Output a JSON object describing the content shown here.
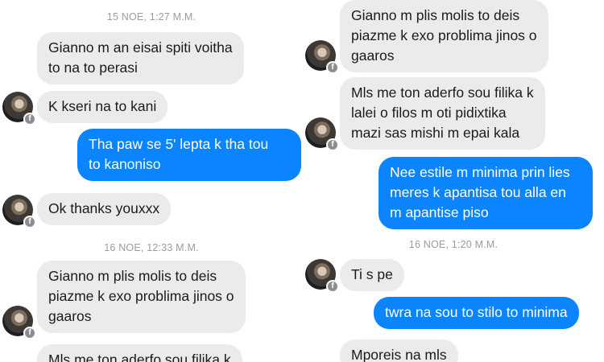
{
  "left": {
    "timestamps": [
      "15 ΝΟΕ, 1:27 Μ.Μ.",
      "16 ΝΟΕ, 12:33 Μ.Μ."
    ],
    "messages": [
      "Gianno m an eisai spiti voitha\nto na to perasi",
      "K kseri na to kani",
      "Tha paw se 5' lepta k tha tou\nto kanoniso",
      "Ok thanks youxxx",
      "Gianno m plis molis to deis\npiazme k exo problima jinos o\ngaaros",
      "Mls me ton aderfo sou filika k"
    ]
  },
  "right": {
    "timestamps": [
      "16 ΝΟΕ, 1:20 Μ.Μ."
    ],
    "messages": [
      "Gianno m plis molis to deis\npiazme k exo problima jinos o\ngaaros",
      "Mls me ton aderfo sou filika k\nlalei o filos m oti pidixtika\nmazi sas mishi m epai kala",
      "Nee estile m minima prin lies\nmeres k apantisa tou alla en\nm apantise piso",
      "Ti s pe",
      "twra na sou to stilo to minima",
      "Mporeis na mls"
    ]
  },
  "icons": {
    "avatar": "profile-photo",
    "badge": "facebook-icon"
  },
  "colors": {
    "incoming_bubble": "#ebebed",
    "outgoing_bubble": "#0a84ff",
    "timestamp": "#9a9ca2"
  }
}
